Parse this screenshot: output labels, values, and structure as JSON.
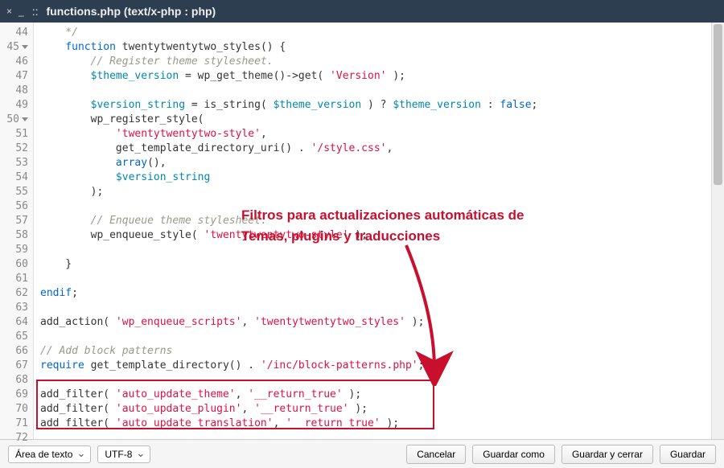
{
  "titlebar": {
    "close": "×",
    "minimize": "_",
    "separator": "::",
    "filename": "functions.php (text/x-php : php)"
  },
  "annotation": {
    "line1": "Filtros para actualizaciones automáticas de",
    "line2": "Temas, plugins y traducciones"
  },
  "code": {
    "lines": [
      {
        "n": "44",
        "tokens": [
          {
            "t": "    */",
            "c": "cmt"
          }
        ]
      },
      {
        "n": "45",
        "fold": true,
        "tokens": [
          {
            "t": "    ",
            "c": ""
          },
          {
            "t": "function",
            "c": "kw"
          },
          {
            "t": " twentytwentytwo_styles() {",
            "c": "fn"
          }
        ]
      },
      {
        "n": "46",
        "tokens": [
          {
            "t": "        ",
            "c": ""
          },
          {
            "t": "// Register theme stylesheet.",
            "c": "cmt"
          }
        ]
      },
      {
        "n": "47",
        "tokens": [
          {
            "t": "        ",
            "c": ""
          },
          {
            "t": "$theme_version",
            "c": "var"
          },
          {
            "t": " = wp_get_theme()->get( ",
            "c": "fn"
          },
          {
            "t": "'Version'",
            "c": "str"
          },
          {
            "t": " );",
            "c": "fn"
          }
        ]
      },
      {
        "n": "48",
        "tokens": []
      },
      {
        "n": "49",
        "tokens": [
          {
            "t": "        ",
            "c": ""
          },
          {
            "t": "$version_string",
            "c": "var"
          },
          {
            "t": " = is_string( ",
            "c": "fn"
          },
          {
            "t": "$theme_version",
            "c": "var"
          },
          {
            "t": " ) ? ",
            "c": "fn"
          },
          {
            "t": "$theme_version",
            "c": "var"
          },
          {
            "t": " : ",
            "c": "fn"
          },
          {
            "t": "false",
            "c": "bool"
          },
          {
            "t": ";",
            "c": "fn"
          }
        ]
      },
      {
        "n": "50",
        "fold": true,
        "tokens": [
          {
            "t": "        wp_register_style(",
            "c": "fn"
          }
        ]
      },
      {
        "n": "51",
        "tokens": [
          {
            "t": "            ",
            "c": ""
          },
          {
            "t": "'twentytwentytwo-style'",
            "c": "str"
          },
          {
            "t": ",",
            "c": "fn"
          }
        ]
      },
      {
        "n": "52",
        "tokens": [
          {
            "t": "            get_template_directory_uri() . ",
            "c": "fn"
          },
          {
            "t": "'/style.css'",
            "c": "str"
          },
          {
            "t": ",",
            "c": "fn"
          }
        ]
      },
      {
        "n": "53",
        "tokens": [
          {
            "t": "            ",
            "c": ""
          },
          {
            "t": "array",
            "c": "kw"
          },
          {
            "t": "(),",
            "c": "fn"
          }
        ]
      },
      {
        "n": "54",
        "tokens": [
          {
            "t": "            ",
            "c": ""
          },
          {
            "t": "$version_string",
            "c": "var"
          }
        ]
      },
      {
        "n": "55",
        "tokens": [
          {
            "t": "        );",
            "c": "fn"
          }
        ]
      },
      {
        "n": "56",
        "tokens": []
      },
      {
        "n": "57",
        "tokens": [
          {
            "t": "        ",
            "c": ""
          },
          {
            "t": "// Enqueue theme stylesheet.",
            "c": "cmt"
          }
        ]
      },
      {
        "n": "58",
        "tokens": [
          {
            "t": "        wp_enqueue_style( ",
            "c": "fn"
          },
          {
            "t": "'twentytwentytwo-style'",
            "c": "str"
          },
          {
            "t": " );",
            "c": "fn"
          }
        ]
      },
      {
        "n": "59",
        "tokens": []
      },
      {
        "n": "60",
        "tokens": [
          {
            "t": "    }",
            "c": "fn"
          }
        ]
      },
      {
        "n": "61",
        "tokens": []
      },
      {
        "n": "62",
        "tokens": [
          {
            "t": "endif",
            "c": "kw"
          },
          {
            "t": ";",
            "c": "fn"
          }
        ]
      },
      {
        "n": "63",
        "tokens": []
      },
      {
        "n": "64",
        "tokens": [
          {
            "t": "add_action( ",
            "c": "fn"
          },
          {
            "t": "'wp_enqueue_scripts'",
            "c": "str"
          },
          {
            "t": ", ",
            "c": "fn"
          },
          {
            "t": "'twentytwentytwo_styles'",
            "c": "str"
          },
          {
            "t": " );",
            "c": "fn"
          }
        ]
      },
      {
        "n": "65",
        "tokens": []
      },
      {
        "n": "66",
        "tokens": [
          {
            "t": "// Add block patterns",
            "c": "cmt"
          }
        ]
      },
      {
        "n": "67",
        "tokens": [
          {
            "t": "require",
            "c": "kw"
          },
          {
            "t": " get_template_directory() . ",
            "c": "fn"
          },
          {
            "t": "'/inc/block-patterns.php'",
            "c": "str"
          },
          {
            "t": ";",
            "c": "fn"
          }
        ]
      },
      {
        "n": "68",
        "tokens": []
      },
      {
        "n": "69",
        "tokens": [
          {
            "t": "add_filter( ",
            "c": "fn"
          },
          {
            "t": "'auto_update_theme'",
            "c": "str"
          },
          {
            "t": ", ",
            "c": "fn"
          },
          {
            "t": "'__return_true'",
            "c": "str"
          },
          {
            "t": " );",
            "c": "fn"
          }
        ]
      },
      {
        "n": "70",
        "tokens": [
          {
            "t": "add_filter( ",
            "c": "fn"
          },
          {
            "t": "'auto_update_plugin'",
            "c": "str"
          },
          {
            "t": ", ",
            "c": "fn"
          },
          {
            "t": "'__return_true'",
            "c": "str"
          },
          {
            "t": " );",
            "c": "fn"
          }
        ]
      },
      {
        "n": "71",
        "tokens": [
          {
            "t": "add_filter( ",
            "c": "fn"
          },
          {
            "t": "'auto_update_translation'",
            "c": "str"
          },
          {
            "t": ", ",
            "c": "fn"
          },
          {
            "t": "'__return_true'",
            "c": "str"
          },
          {
            "t": " );",
            "c": "fn"
          }
        ]
      },
      {
        "n": "72",
        "tokens": []
      }
    ]
  },
  "footer": {
    "mode": "Área de texto",
    "encoding": "UTF-8",
    "cancel": "Cancelar",
    "save_as": "Guardar como",
    "save_close": "Guardar y cerrar",
    "save": "Guardar"
  }
}
